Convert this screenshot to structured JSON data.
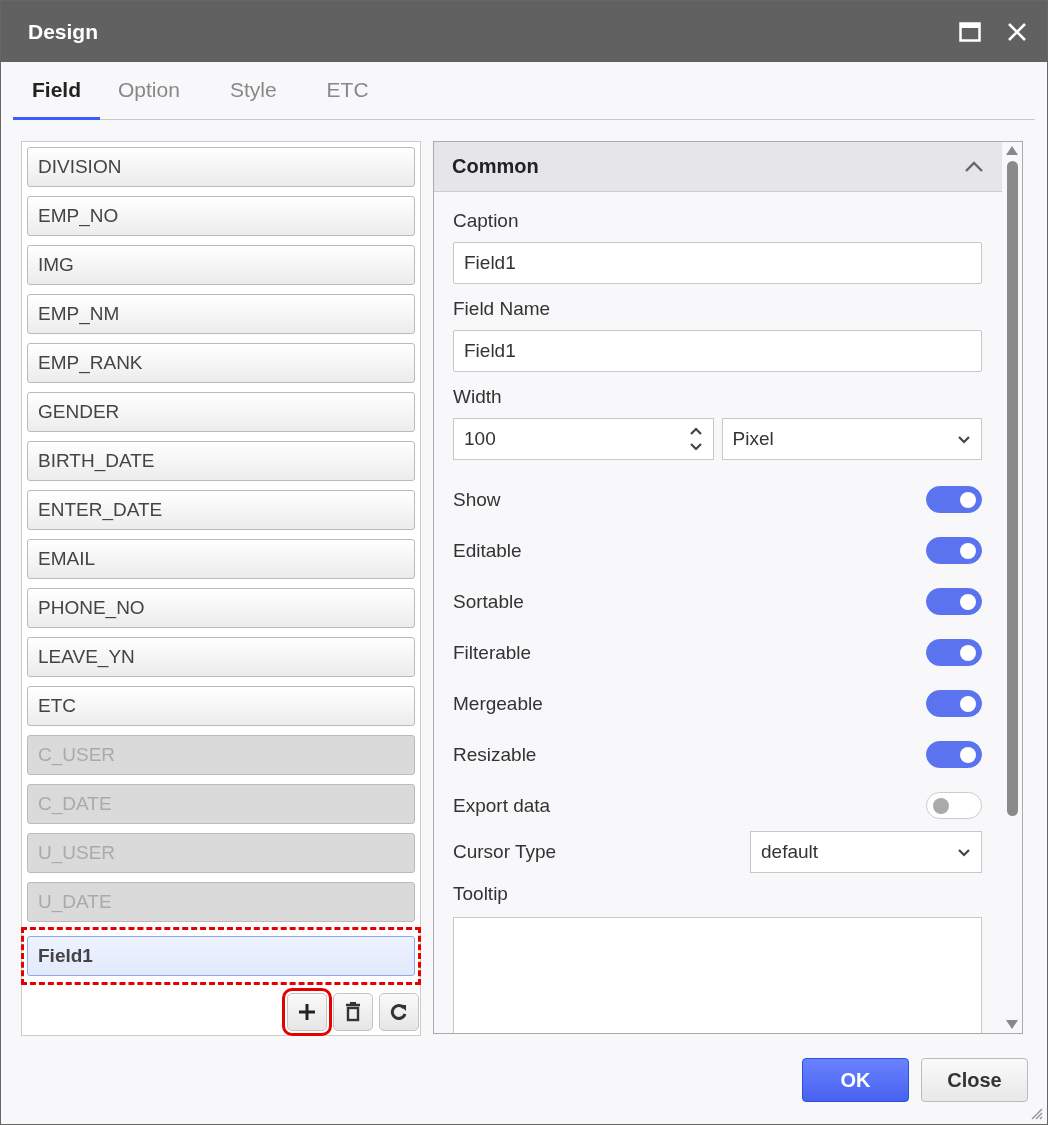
{
  "window": {
    "title": "Design"
  },
  "tabs": [
    {
      "label": "Field",
      "selected": true
    },
    {
      "label": "Option",
      "selected": false
    },
    {
      "label": "Style",
      "selected": false
    },
    {
      "label": "ETC",
      "selected": false
    }
  ],
  "fields": [
    {
      "label": "DIVISION",
      "disabled": false,
      "selected": false,
      "highlighted": false
    },
    {
      "label": "EMP_NO",
      "disabled": false,
      "selected": false,
      "highlighted": false
    },
    {
      "label": "IMG",
      "disabled": false,
      "selected": false,
      "highlighted": false
    },
    {
      "label": "EMP_NM",
      "disabled": false,
      "selected": false,
      "highlighted": false
    },
    {
      "label": "EMP_RANK",
      "disabled": false,
      "selected": false,
      "highlighted": false
    },
    {
      "label": "GENDER",
      "disabled": false,
      "selected": false,
      "highlighted": false
    },
    {
      "label": "BIRTH_DATE",
      "disabled": false,
      "selected": false,
      "highlighted": false
    },
    {
      "label": "ENTER_DATE",
      "disabled": false,
      "selected": false,
      "highlighted": false
    },
    {
      "label": "EMAIL",
      "disabled": false,
      "selected": false,
      "highlighted": false
    },
    {
      "label": "PHONE_NO",
      "disabled": false,
      "selected": false,
      "highlighted": false
    },
    {
      "label": "LEAVE_YN",
      "disabled": false,
      "selected": false,
      "highlighted": false
    },
    {
      "label": "ETC",
      "disabled": false,
      "selected": false,
      "highlighted": false
    },
    {
      "label": "C_USER",
      "disabled": true,
      "selected": false,
      "highlighted": false
    },
    {
      "label": "C_DATE",
      "disabled": true,
      "selected": false,
      "highlighted": false
    },
    {
      "label": "U_USER",
      "disabled": true,
      "selected": false,
      "highlighted": false
    },
    {
      "label": "U_DATE",
      "disabled": true,
      "selected": false,
      "highlighted": false
    },
    {
      "label": "Field1",
      "disabled": false,
      "selected": true,
      "highlighted": true
    }
  ],
  "list_buttons": [
    {
      "kind": "add",
      "highlighted": true
    },
    {
      "kind": "delete",
      "highlighted": false
    },
    {
      "kind": "refresh",
      "highlighted": false
    }
  ],
  "section": {
    "title": "Common",
    "expanded": true
  },
  "properties": [
    {
      "kind": "text",
      "label": "Caption",
      "value": "Field1"
    },
    {
      "kind": "text",
      "label": "Field Name",
      "value": "Field1"
    },
    {
      "kind": "width",
      "label": "Width",
      "value": "100",
      "unit": "Pixel"
    },
    {
      "kind": "toggle",
      "label": "Show",
      "on": true
    },
    {
      "kind": "toggle",
      "label": "Editable",
      "on": true
    },
    {
      "kind": "toggle",
      "label": "Sortable",
      "on": true
    },
    {
      "kind": "toggle",
      "label": "Filterable",
      "on": true
    },
    {
      "kind": "toggle",
      "label": "Mergeable",
      "on": true
    },
    {
      "kind": "toggle",
      "label": "Resizable",
      "on": true
    },
    {
      "kind": "toggle",
      "label": "Export data",
      "on": false
    },
    {
      "kind": "select",
      "label": "Cursor Type",
      "value": "default"
    },
    {
      "kind": "textarea",
      "label": "Tooltip"
    }
  ],
  "buttons": [
    {
      "label": "OK",
      "primary": true
    },
    {
      "label": "Close",
      "primary": false
    }
  ]
}
